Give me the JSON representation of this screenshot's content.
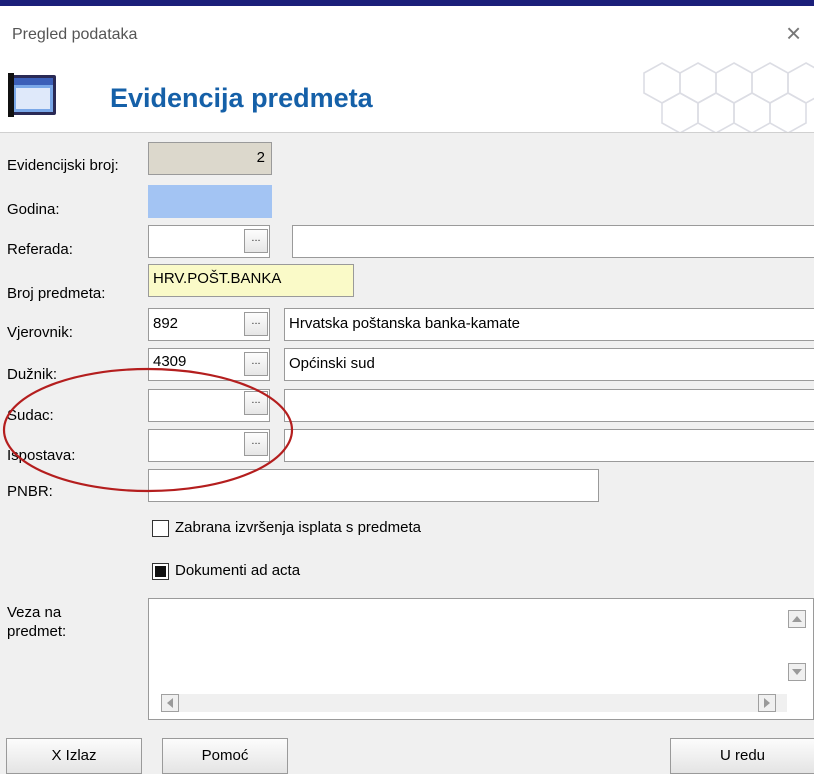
{
  "window": {
    "title": "Pregled podataka",
    "close_glyph": "×"
  },
  "header": {
    "title": "Evidencija predmeta",
    "icon": "window-app-icon"
  },
  "labels": {
    "evidencijski_broj": "Evidencijski broj:",
    "godina": "Godina:",
    "referada": "Referada:",
    "broj_predmeta": "Broj predmeta:",
    "vjerovnik": "Vjerovnik:",
    "duznik": "Dužnik:",
    "sudac": "Sudac:",
    "ispostava": "Ispostava:",
    "pnbr": "PNBR:",
    "veza_na_predmet": "Veza na\npredmet:"
  },
  "fields": {
    "evidencijski_broj": "2",
    "godina": "",
    "referada_code": "",
    "referada_name": "",
    "broj_predmeta": "HRV.POŠT.BANKA",
    "vjerovnik_code": "892",
    "vjerovnik_name": "Hrvatska poštanska banka-kamate",
    "duznik_code": "4309",
    "duznik_name": "Općinski sud",
    "sudac_code": "",
    "sudac_name": "",
    "ispostava_code": "",
    "ispostava_name": "",
    "pnbr": "",
    "veza_na_predmet": ""
  },
  "lookup_button_label": "...",
  "checkboxes": {
    "zabrana": {
      "label": "Zabrana izvršenja isplata s predmeta",
      "checked": false
    },
    "ad_acta": {
      "label": "Dokumenti ad acta",
      "checked": true
    }
  },
  "buttons": {
    "izlaz": "X Izlaz",
    "pomoc": "Pomoć",
    "u_redu": "U redu"
  },
  "colors": {
    "title_blue": "#1560a8",
    "readonly_field": "#dcd8cc",
    "godina_field": "#a3c4f3",
    "broj_predmeta_field": "#fafac8",
    "annotation_ellipse": "#b41e1e"
  }
}
